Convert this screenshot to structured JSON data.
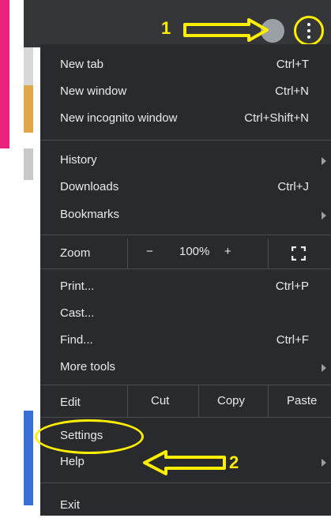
{
  "colors": {
    "menu_bg": "#292a2d",
    "menu_text": "#e8eaed",
    "annotation": "#ffee00",
    "accent_pink": "#e8237e"
  },
  "annotations": {
    "step1": "1",
    "step2": "2"
  },
  "menu": {
    "new_tab": {
      "label": "New tab",
      "shortcut": "Ctrl+T"
    },
    "new_window": {
      "label": "New window",
      "shortcut": "Ctrl+N"
    },
    "new_incognito": {
      "label": "New incognito window",
      "shortcut": "Ctrl+Shift+N"
    },
    "history": {
      "label": "History"
    },
    "downloads": {
      "label": "Downloads",
      "shortcut": "Ctrl+J"
    },
    "bookmarks": {
      "label": "Bookmarks"
    },
    "zoom": {
      "label": "Zoom",
      "minus": "−",
      "level": "100%",
      "plus": "+",
      "fullscreen_icon": "fullscreen-icon"
    },
    "print": {
      "label": "Print...",
      "shortcut": "Ctrl+P"
    },
    "cast": {
      "label": "Cast..."
    },
    "find": {
      "label": "Find...",
      "shortcut": "Ctrl+F"
    },
    "more_tools": {
      "label": "More tools"
    },
    "edit": {
      "label": "Edit",
      "cut": "Cut",
      "copy": "Copy",
      "paste": "Paste"
    },
    "settings": {
      "label": "Settings"
    },
    "help": {
      "label": "Help"
    },
    "exit": {
      "label": "Exit"
    }
  }
}
